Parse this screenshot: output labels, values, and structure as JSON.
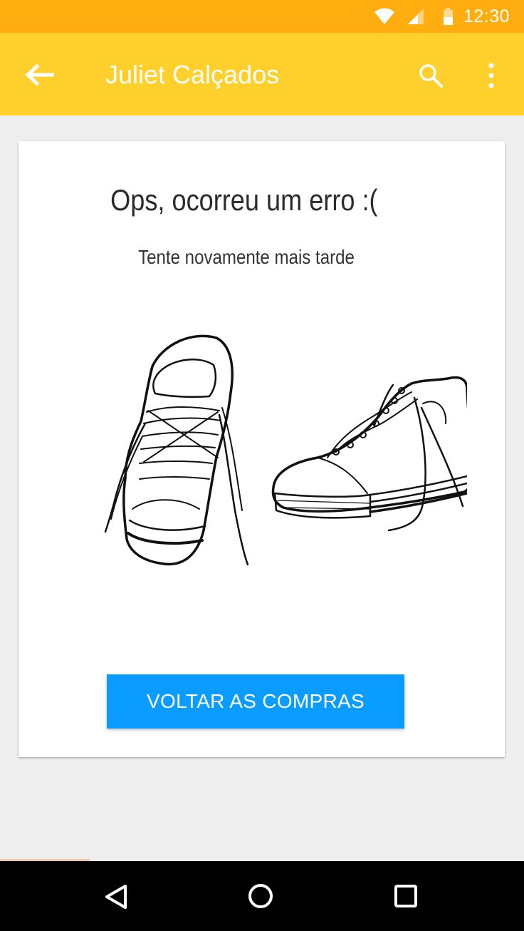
{
  "status_bar": {
    "time": "12:30",
    "icons": [
      "wifi-icon",
      "cell-signal-icon",
      "battery-icon"
    ],
    "background": "#ffad0f"
  },
  "app_bar": {
    "title": "Juliet Calçados",
    "back_icon": "arrow-left-icon",
    "search_icon": "search-icon",
    "menu_icon": "more-vertical-icon",
    "background": "#ffd02b"
  },
  "error_card": {
    "title": "Ops, ocorreu um erro :(",
    "subtitle": "Tente novamente mais tarde",
    "illustration": "sneakers-illustration",
    "button_label": "VOLTAR AS COMPRAS",
    "button_color": "#0b9cff"
  },
  "nav_bar": {
    "icons": [
      "back-triangle-icon",
      "home-circle-icon",
      "recents-square-icon"
    ]
  }
}
